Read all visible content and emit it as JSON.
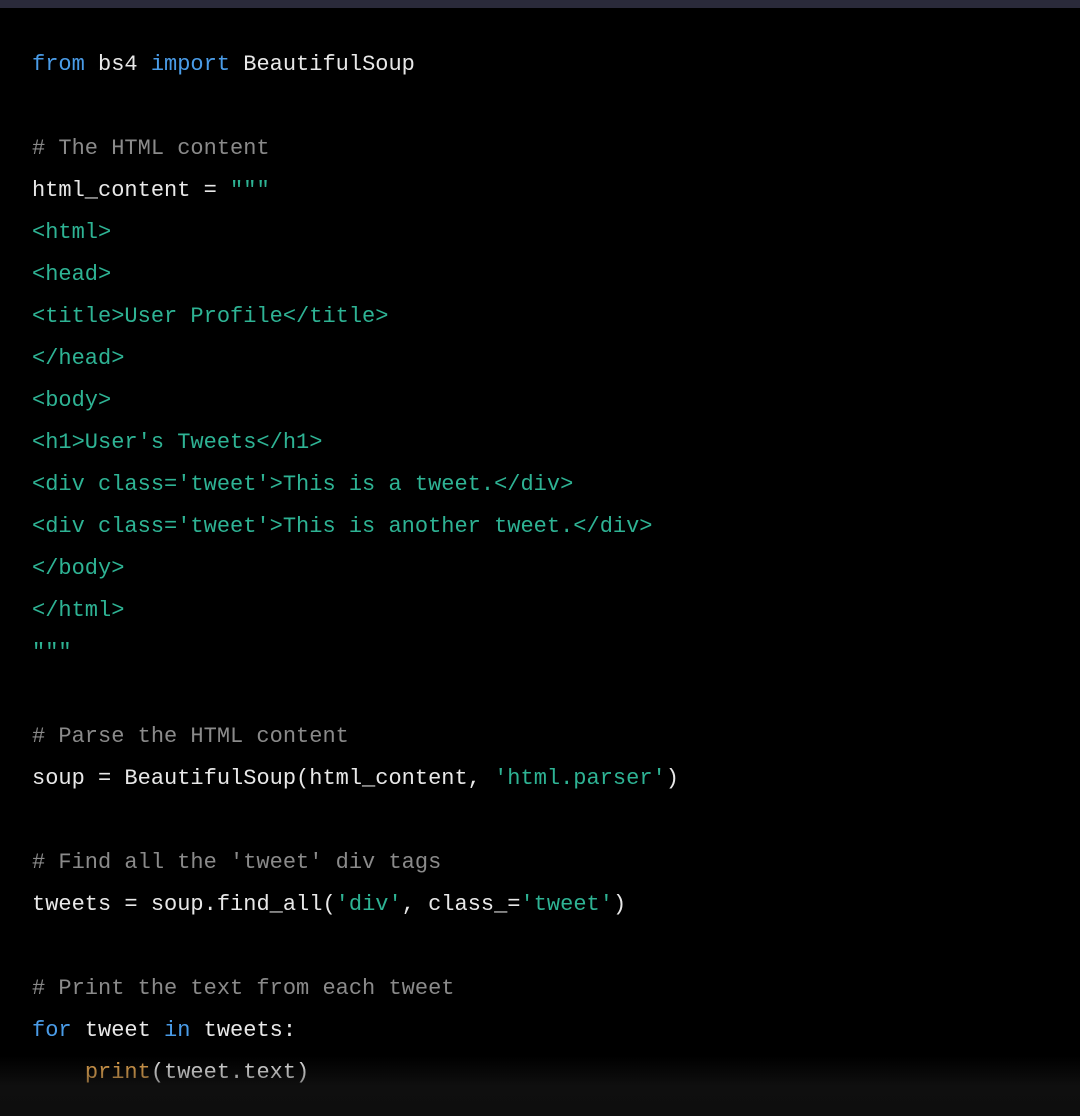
{
  "code": {
    "tokens": [
      [
        {
          "t": "from ",
          "c": "kw-from"
        },
        {
          "t": "bs4 ",
          "c": "ident"
        },
        {
          "t": "import ",
          "c": "kw-import"
        },
        {
          "t": "BeautifulSoup",
          "c": "ident"
        }
      ],
      [],
      [
        {
          "t": "# The HTML content",
          "c": "comment"
        }
      ],
      [
        {
          "t": "html_content ",
          "c": "ident"
        },
        {
          "t": "= ",
          "c": "op"
        },
        {
          "t": "\"\"\"",
          "c": "string"
        }
      ],
      [
        {
          "t": "<html>",
          "c": "string"
        }
      ],
      [
        {
          "t": "<head>",
          "c": "string"
        }
      ],
      [
        {
          "t": "<title>User Profile</title>",
          "c": "string"
        }
      ],
      [
        {
          "t": "</head>",
          "c": "string"
        }
      ],
      [
        {
          "t": "<body>",
          "c": "string"
        }
      ],
      [
        {
          "t": "<h1>User's Tweets</h1>",
          "c": "string"
        }
      ],
      [
        {
          "t": "<div class='tweet'>This is a tweet.</div>",
          "c": "string"
        }
      ],
      [
        {
          "t": "<div class='tweet'>This is another tweet.</div>",
          "c": "string"
        }
      ],
      [
        {
          "t": "</body>",
          "c": "string"
        }
      ],
      [
        {
          "t": "</html>",
          "c": "string"
        }
      ],
      [
        {
          "t": "\"\"\"",
          "c": "string"
        }
      ],
      [],
      [
        {
          "t": "# Parse the HTML content",
          "c": "comment"
        }
      ],
      [
        {
          "t": "soup ",
          "c": "ident"
        },
        {
          "t": "= ",
          "c": "op"
        },
        {
          "t": "BeautifulSoup(html_content, ",
          "c": "ident"
        },
        {
          "t": "'html.parser'",
          "c": "string"
        },
        {
          "t": ")",
          "c": "ident"
        }
      ],
      [],
      [
        {
          "t": "# Find all the 'tweet' div tags",
          "c": "comment"
        }
      ],
      [
        {
          "t": "tweets ",
          "c": "ident"
        },
        {
          "t": "= ",
          "c": "op"
        },
        {
          "t": "soup.find_all(",
          "c": "ident"
        },
        {
          "t": "'div'",
          "c": "string"
        },
        {
          "t": ", class_=",
          "c": "ident"
        },
        {
          "t": "'tweet'",
          "c": "string"
        },
        {
          "t": ")",
          "c": "ident"
        }
      ],
      [],
      [
        {
          "t": "# Print the text from each tweet",
          "c": "comment"
        }
      ],
      [
        {
          "t": "for ",
          "c": "kw-for"
        },
        {
          "t": "tweet ",
          "c": "ident"
        },
        {
          "t": "in ",
          "c": "kw-in"
        },
        {
          "t": "tweets:",
          "c": "ident"
        }
      ],
      [
        {
          "t": "    ",
          "c": "ident"
        },
        {
          "t": "print",
          "c": "func"
        },
        {
          "t": "(tweet.text)",
          "c": "ident"
        }
      ]
    ]
  }
}
